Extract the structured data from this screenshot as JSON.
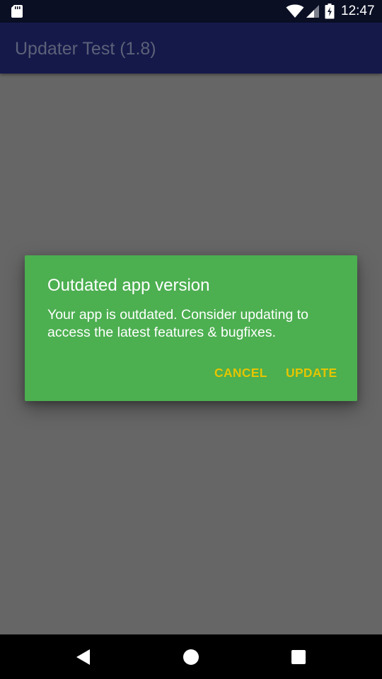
{
  "status_bar": {
    "time": "12:47",
    "icons": [
      "sd-card-icon",
      "wifi-icon",
      "cell-signal-icon",
      "battery-charging-icon"
    ]
  },
  "app_bar": {
    "title": "Updater Test (1.8)"
  },
  "dialog": {
    "title": "Outdated app version",
    "message": "Your app is outdated. Consider updating to access the latest features & bugfixes.",
    "cancel_label": "CANCEL",
    "update_label": "UPDATE",
    "background_color": "#4caf50",
    "button_color": "#e5c500"
  },
  "nav_bar": {
    "icons": [
      "back-icon",
      "home-icon",
      "recents-icon"
    ]
  }
}
